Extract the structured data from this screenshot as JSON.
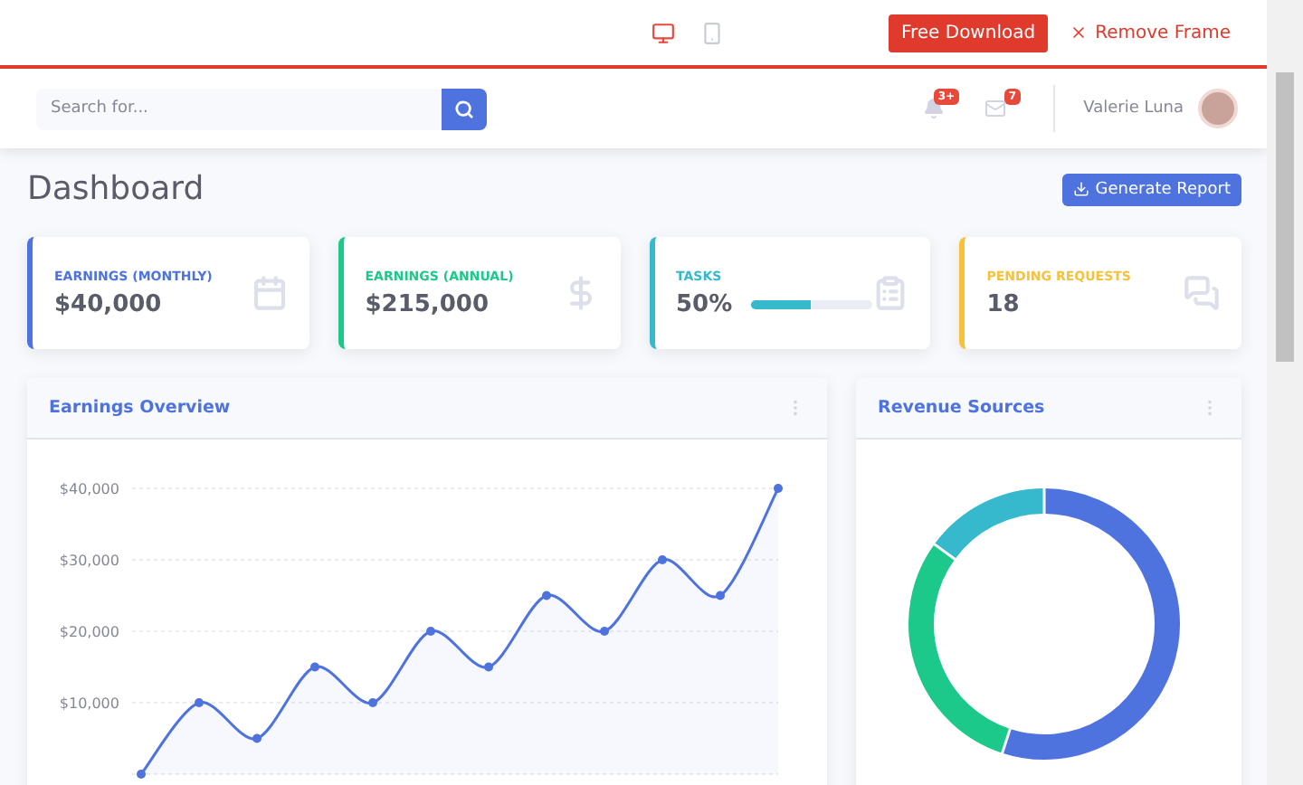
{
  "frame_bar": {
    "devices": [
      {
        "kind": "desktop",
        "selected": true
      },
      {
        "kind": "mobile",
        "selected": false
      }
    ],
    "download_button": "Free Download",
    "remove_frame": "Remove Frame"
  },
  "topbar": {
    "search": {
      "placeholder": "Search for..."
    },
    "alerts_badge": "3+",
    "messages_badge": "7",
    "user_name": "Valerie Luna"
  },
  "page": {
    "title": "Dashboard",
    "report_button": "Generate Report"
  },
  "cards": [
    {
      "kind": "stat",
      "label": "EARNINGS (MONTHLY)",
      "value": "$40,000",
      "color": "#4e73df"
    },
    {
      "kind": "stat",
      "label": "EARNINGS (ANNUAL)",
      "value": "$215,000",
      "color": "#1cc88a"
    },
    {
      "kind": "progress",
      "label": "TASKS",
      "value": "50%",
      "level": 0.5,
      "color": "#36b9cc"
    },
    {
      "kind": "stat",
      "label": "PENDING REQUESTS",
      "value": "18",
      "color": "#f6c23e"
    }
  ],
  "earnings_overview": {
    "title": "Earnings Overview",
    "chart_data": {
      "type": "area",
      "grid": true,
      "categories": [
        null,
        null,
        null,
        null,
        null,
        null,
        null,
        null,
        null,
        null,
        null,
        null
      ],
      "ylim": [
        0,
        40000
      ],
      "yticks": [
        {
          "value": 10000,
          "label": "$10,000"
        },
        {
          "value": 20000,
          "label": "$20,000"
        },
        {
          "value": 30000,
          "label": "$30,000"
        },
        {
          "value": 40000,
          "label": "$40,000"
        }
      ],
      "series": [
        {
          "color": "#4e73df",
          "marker": true,
          "values": [
            0,
            10000,
            5000,
            15000,
            10000,
            20000,
            15000,
            25000,
            20000,
            30000,
            25000,
            40000
          ]
        }
      ]
    }
  },
  "revenue_sources": {
    "title": "Revenue Sources"
  }
}
